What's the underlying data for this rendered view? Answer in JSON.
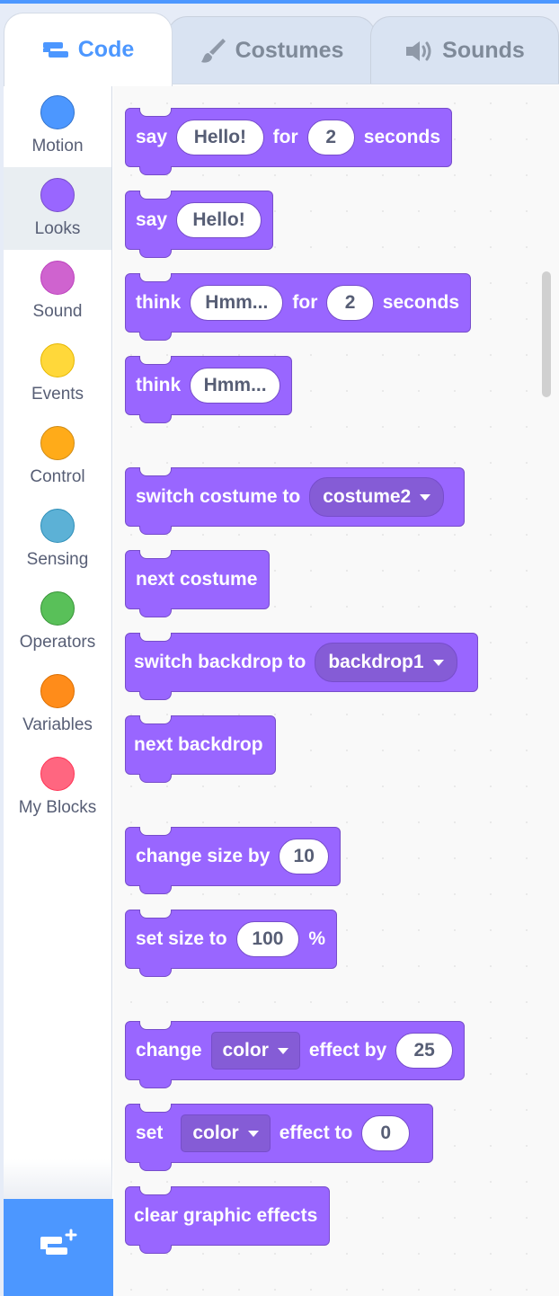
{
  "tabs": [
    {
      "label": "Code",
      "icon": "code-icon",
      "active": true
    },
    {
      "label": "Costumes",
      "icon": "brush-icon",
      "active": false
    },
    {
      "label": "Sounds",
      "icon": "speaker-icon",
      "active": false
    }
  ],
  "categories": [
    {
      "label": "Motion",
      "color": "#4c97ff"
    },
    {
      "label": "Looks",
      "color": "#9966ff"
    },
    {
      "label": "Sound",
      "color": "#cf63cf"
    },
    {
      "label": "Events",
      "color": "#ffd83a"
    },
    {
      "label": "Control",
      "color": "#ffab19"
    },
    {
      "label": "Sensing",
      "color": "#5cb1d6"
    },
    {
      "label": "Operators",
      "color": "#59c059"
    },
    {
      "label": "Variables",
      "color": "#ff8c1a"
    },
    {
      "label": "My Blocks",
      "color": "#ff6680"
    }
  ],
  "selected_category": "Looks",
  "colors": {
    "looks": "#9966ff",
    "looks_dark": "#774dcb",
    "accent": "#4c97ff"
  },
  "blocks": {
    "say_for": {
      "say": "say",
      "message": "Hello!",
      "for": "for",
      "secs": "2",
      "seconds": "seconds"
    },
    "say": {
      "say": "say",
      "message": "Hello!"
    },
    "think_for": {
      "think": "think",
      "message": "Hmm...",
      "for": "for",
      "secs": "2",
      "seconds": "seconds"
    },
    "think": {
      "think": "think",
      "message": "Hmm..."
    },
    "switch_costume": {
      "label": "switch costume to",
      "value": "costume2"
    },
    "next_costume": {
      "label": "next costume"
    },
    "switch_backdrop": {
      "label": "switch backdrop to",
      "value": "backdrop1"
    },
    "next_backdrop": {
      "label": "next backdrop"
    },
    "change_size": {
      "label": "change size by",
      "value": "10"
    },
    "set_size": {
      "label": "set size to",
      "value": "100",
      "unit": "%"
    },
    "change_effect": {
      "change": "change",
      "effect": "color",
      "by": "effect by",
      "value": "25"
    },
    "set_effect": {
      "set": "set",
      "effect": "color",
      "to": "effect to",
      "value": "0"
    },
    "clear_effects": {
      "label": "clear graphic effects"
    }
  }
}
